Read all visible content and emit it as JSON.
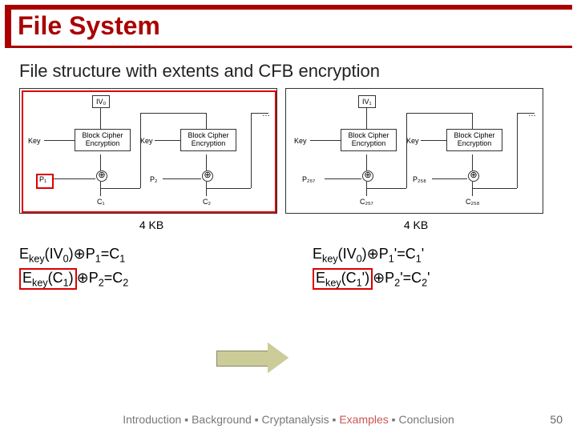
{
  "title": "File System",
  "subtitle": "File structure with extents and CFB encryption",
  "diagram": {
    "left": {
      "iv": "IV₀",
      "key": "Key",
      "block": "Block Cipher Encryption",
      "p1": "P₁",
      "p2": "P₂",
      "c1": "C₁",
      "c2": "C₂",
      "size": "4 KB"
    },
    "right": {
      "iv": "IV₁",
      "key": "Key",
      "block": "Block Cipher Encryption",
      "p1": "P₂₅₇",
      "p2": "P₂₅₈",
      "c1": "C₂₅₇",
      "c2": "C₂₅₈",
      "size": "4 KB"
    },
    "dots": "…"
  },
  "equations": {
    "left": {
      "line1_pre": "E",
      "line1_key": "key",
      "line1_mid": "(IV",
      "line1_sub0": "0",
      "line1_post": ")⊕P",
      "line1_sub1": "1",
      "line1_eq": "=C",
      "line1_sub2": "1",
      "line2_pre": "E",
      "line2_key": "key",
      "line2_mid": "(C",
      "line2_sub0": "1",
      "line2_post": ")",
      "line2_op": "⊕P",
      "line2_sub1": "2",
      "line2_eq": "=C",
      "line2_sub2": "2"
    },
    "right": {
      "line1_pre": "E",
      "line1_key": "key",
      "line1_mid": "(IV",
      "line1_sub0": "0",
      "line1_post": ")⊕P",
      "line1_sub1": "1",
      "line1_prime1": "'",
      "line1_eq": "=C",
      "line1_sub2": "1",
      "line1_prime2": "'",
      "line2_pre": "E",
      "line2_key": "key",
      "line2_mid": "(C",
      "line2_sub0": "1",
      "line2_prime_in": "'",
      "line2_post": ")",
      "line2_op": "⊕P",
      "line2_sub1": "2",
      "line2_prime1": "'",
      "line2_eq": "=C",
      "line2_sub2": "2",
      "line2_prime2": "'"
    }
  },
  "footer": {
    "t1": "Introduction ▪ Background ▪ Cryptanalysis ▪ ",
    "ex": "Examples",
    "t2": " ▪ Conclusion"
  },
  "page": "50"
}
